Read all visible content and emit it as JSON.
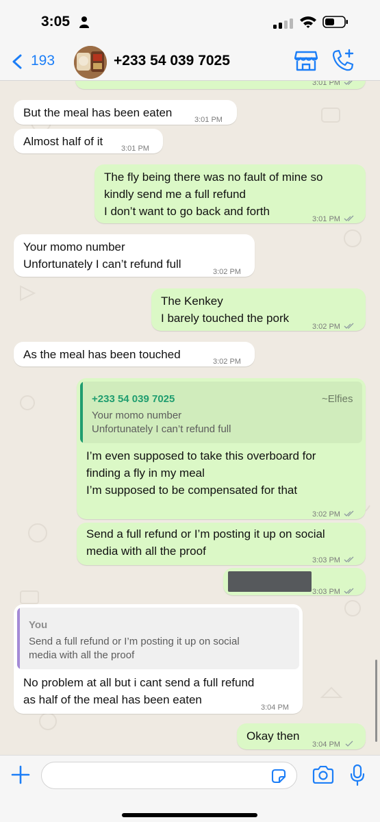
{
  "status_bar": {
    "time": "3:05"
  },
  "header": {
    "back_count": "193",
    "contact_name": "+233 54 039 7025"
  },
  "colors": {
    "accent": "#1c7ef7",
    "outgoing_bubble": "#dbf8c6",
    "incoming_bubble": "#ffffff",
    "quote_author_green": "#1f9d6f",
    "quote_you_purple": "#a48ad6",
    "chat_background": "#efeae2"
  },
  "messages": [
    {
      "direction": "out",
      "text": "",
      "time": "3:01 PM",
      "status": "read"
    },
    {
      "direction": "in",
      "text": "But the meal has been eaten",
      "time": "3:01 PM"
    },
    {
      "direction": "in",
      "text": "Almost half of it",
      "time": "3:01 PM"
    },
    {
      "direction": "out",
      "text": "The fly being there was no fault of mine so\nkindly send me a full refund\nI don’t want to go back and forth",
      "time": "3:01 PM",
      "status": "read"
    },
    {
      "direction": "in",
      "text": "Your momo number\nUnfortunately I can’t refund full",
      "time": "3:02 PM"
    },
    {
      "direction": "out",
      "text": "The Kenkey\nI barely touched the pork",
      "time": "3:02 PM",
      "status": "read"
    },
    {
      "direction": "in",
      "text": "As the meal has been touched",
      "time": "3:02 PM"
    },
    {
      "direction": "out",
      "quote": {
        "author": "+233 54 039 7025",
        "alias": "~Elfies",
        "text": "Your momo number\nUnfortunately I can’t refund full"
      },
      "text": "I’m even supposed to take this overboard for\nfinding a fly in my meal\nI’m supposed to be compensated for that",
      "time": "3:02 PM",
      "status": "read"
    },
    {
      "direction": "out",
      "text": "Send a full refund or I’m posting it up on social\nmedia with all the proof",
      "time": "3:03 PM",
      "status": "read"
    },
    {
      "direction": "out",
      "text": "",
      "redacted": true,
      "time": "3:03 PM",
      "status": "read"
    },
    {
      "direction": "in",
      "quote": {
        "author": "You",
        "text": "Send a full refund or I’m posting it up on social\nmedia with all the proof"
      },
      "text": "No problem at all but i cant send a full refund\nas half of the meal has been eaten",
      "time": "3:04 PM"
    },
    {
      "direction": "out",
      "text": "Okay then",
      "time": "3:04 PM",
      "status": "sent"
    }
  ],
  "input": {
    "placeholder": ""
  },
  "icons": [
    "person-icon",
    "signal-icon",
    "wifi-icon",
    "battery-icon",
    "back-chevron-icon",
    "store-icon",
    "call-add-icon",
    "double-check-icon",
    "single-check-icon",
    "plus-icon",
    "sticker-icon",
    "camera-icon",
    "mic-icon"
  ]
}
